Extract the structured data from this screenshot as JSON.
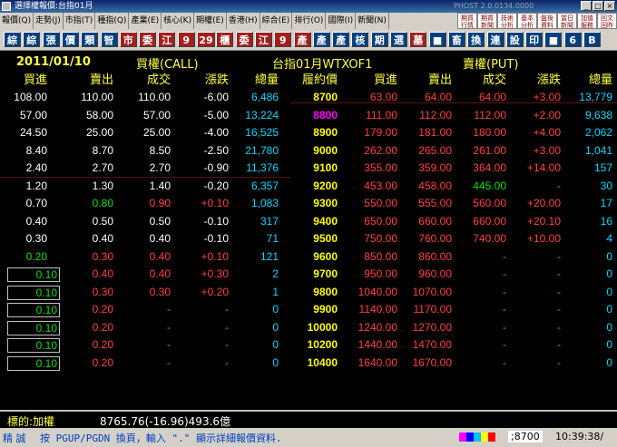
{
  "window": {
    "title": "選擇權報價:台指01月",
    "version": "PHOST 2.0.0134.0000"
  },
  "menu": [
    "報價(Q)",
    "走勢(J)",
    "市指(T)",
    "種指(Q)",
    "產業(E)",
    "核心(K)",
    "期權(E)",
    "香港(H)",
    "綜合(E)",
    "排行(O)",
    "國際(I)",
    "新聞(N)"
  ],
  "quick_buttons": [
    [
      "期貨",
      "行情"
    ],
    [
      "期貨",
      "新聞"
    ],
    [
      "技術",
      "分析"
    ],
    [
      "基本",
      "分析"
    ],
    [
      "盤後",
      "資料"
    ],
    [
      "當日",
      "新聞"
    ],
    [
      "加值",
      "服務"
    ],
    [
      "回文",
      "回昨"
    ]
  ],
  "toolbar": [
    {
      "t": "綜",
      "c": "#004080"
    },
    {
      "t": "綜",
      "c": "#004080"
    },
    {
      "t": "張",
      "c": "#004080"
    },
    {
      "t": "價",
      "c": "#004080"
    },
    {
      "t": "類",
      "c": "#004080"
    },
    {
      "t": "智",
      "c": "#004080"
    },
    {
      "t": "市",
      "c": "#a02020"
    },
    {
      "t": "委",
      "c": "#a02020"
    },
    {
      "t": "江",
      "c": "#a02020"
    },
    {
      "t": "9",
      "c": "#a02020"
    },
    {
      "t": "29",
      "c": "#a02020"
    },
    {
      "t": "櫃",
      "c": "#a02020"
    },
    {
      "t": "委",
      "c": "#a02020"
    },
    {
      "t": "江",
      "c": "#a02020"
    },
    {
      "t": "9",
      "c": "#a02020"
    },
    {
      "t": "產",
      "c": "#a02020"
    },
    {
      "t": "產",
      "c": "#004080"
    },
    {
      "t": "產",
      "c": "#004080"
    },
    {
      "t": "核",
      "c": "#004080"
    },
    {
      "t": "期",
      "c": "#004080"
    },
    {
      "t": "選",
      "c": "#004080"
    },
    {
      "t": "墓",
      "c": "#a02020"
    },
    {
      "t": "■",
      "c": "#004080"
    },
    {
      "t": "畜",
      "c": "#004080"
    },
    {
      "t": "換",
      "c": "#004080"
    },
    {
      "t": "連",
      "c": "#004080"
    },
    {
      "t": "設",
      "c": "#004080"
    },
    {
      "t": "印",
      "c": "#004080"
    },
    {
      "t": "■",
      "c": "#004080"
    },
    {
      "t": "6",
      "c": "#004080"
    },
    {
      "t": "B",
      "c": "#004080"
    }
  ],
  "header": {
    "date": "2011/01/10",
    "call_title": "買權(CALL)",
    "center_title": "台指01月WTXOF1",
    "put_title": "賣權(PUT)"
  },
  "columns": [
    "買進",
    "賣出",
    "成交",
    "漲跌",
    "總量",
    "履約價",
    "買進",
    "賣出",
    "成交",
    "漲跌",
    "總量"
  ],
  "rows": [
    [
      "108.00",
      "110.00",
      "110.00",
      "-6.00",
      "6,486",
      "8700",
      "63.00",
      "64.00",
      "64.00",
      "+3.00",
      "13,779"
    ],
    [
      "57.00",
      "58.00",
      "57.00",
      "-5.00",
      "13,224",
      "8800",
      "111.00",
      "112.00",
      "112.00",
      "+2.00",
      "9,638"
    ],
    [
      "24.50",
      "25.00",
      "25.00",
      "-4.00",
      "16,525",
      "8900",
      "179.00",
      "181.00",
      "180.00",
      "+4.00",
      "2,062"
    ],
    [
      "8.40",
      "8.70",
      "8.50",
      "-2.50",
      "21,780",
      "9000",
      "262.00",
      "265.00",
      "261.00",
      "+3.00",
      "1,041"
    ],
    [
      "2.40",
      "2.70",
      "2.70",
      "-0.90",
      "11,376",
      "9100",
      "355.00",
      "359.00",
      "364.00",
      "+14.00",
      "157"
    ],
    [
      "1.20",
      "1.30",
      "1.40",
      "-0.20",
      "6,357",
      "9200",
      "453.00",
      "458.00",
      "445.00",
      "-",
      "30"
    ],
    [
      "0.70",
      "0.80",
      "0.90",
      "+0.10",
      "1,083",
      "9300",
      "550.00",
      "555.00",
      "560.00",
      "+20.00",
      "17"
    ],
    [
      "0.40",
      "0.50",
      "0.50",
      "-0.10",
      "317",
      "9400",
      "650.00",
      "660.00",
      "660.00",
      "+20.10",
      "16"
    ],
    [
      "0.30",
      "0.40",
      "0.40",
      "-0.10",
      "71",
      "9500",
      "750.00",
      "760.00",
      "740.00",
      "+10.00",
      "4"
    ],
    [
      "0.20",
      "0.30",
      "0.40",
      "+0.10",
      "121",
      "9600",
      "850.00",
      "860.00",
      "-",
      "-",
      "0"
    ],
    [
      "0.10",
      "0.40",
      "0.40",
      "+0.30",
      "2",
      "9700",
      "950.00",
      "960.00",
      "-",
      "-",
      "0"
    ],
    [
      "0.10",
      "0.30",
      "0.30",
      "+0.20",
      "1",
      "9800",
      "1040.00",
      "1070.00",
      "-",
      "-",
      "0"
    ],
    [
      "0.10",
      "0.20",
      "-",
      "-",
      "0",
      "9900",
      "1140.00",
      "1170.00",
      "-",
      "-",
      "0"
    ],
    [
      "0.10",
      "0.20",
      "-",
      "-",
      "0",
      "10000",
      "1240.00",
      "1270.00",
      "-",
      "-",
      "0"
    ],
    [
      "0.10",
      "0.20",
      "-",
      "-",
      "0",
      "10200",
      "1440.00",
      "1470.00",
      "-",
      "-",
      "0"
    ],
    [
      "0.10",
      "0.20",
      "-",
      "-",
      "0",
      "10400",
      "1640.00",
      "1670.00",
      "-",
      "-",
      "0"
    ]
  ],
  "status": {
    "underlying_label": "標的:加權",
    "underlying_value": "8765.76(-16.96)493.6億",
    "hint_prefix": "精 誠",
    "hint": "按 PGUP/PGDN 換頁，輸入 \".\" 顯示詳細報價資料.",
    "code": ";8700",
    "clock": "10:39:38/"
  },
  "colors": {
    "white": "#ffffff",
    "red": "#ff4040",
    "green": "#00e000",
    "cyan": "#00d8ff",
    "yellow": "#ffff00",
    "magenta": "#ff00ff",
    "header": "#ffff40"
  }
}
